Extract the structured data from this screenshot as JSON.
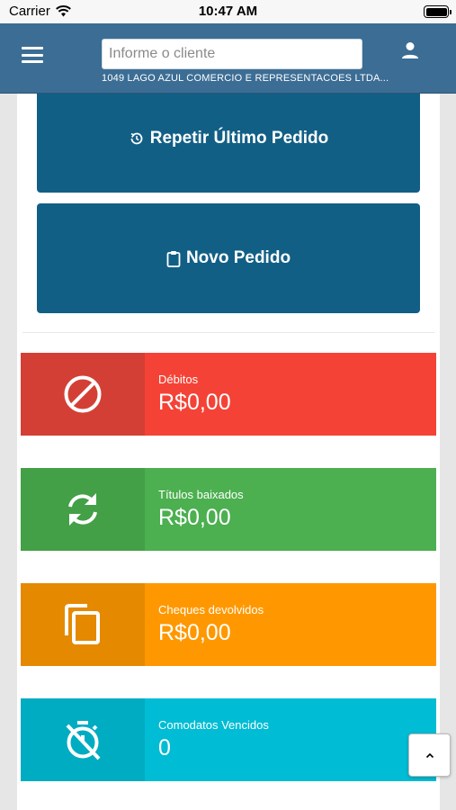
{
  "status_bar": {
    "carrier": "Carrier",
    "time": "10:47 AM"
  },
  "header": {
    "menu_icon": "hamburger-menu-icon",
    "search_placeholder": "Informe o cliente",
    "client_name": "1049 LAGO AZUL COMERCIO E REPRESENTACOES LTDA...",
    "user_icon": "user-icon"
  },
  "actions": {
    "repeat_label": "Repetir Último Pedido",
    "repeat_icon": "history-icon",
    "new_label": "Novo Pedido",
    "new_icon": "clipboard-icon"
  },
  "cards": [
    {
      "label": "Débitos",
      "value": "R$0,00",
      "icon": "block-icon",
      "color": "#f44336",
      "icon_bg": "#d43f35"
    },
    {
      "label": "Títulos baixados",
      "value": "R$0,00",
      "icon": "sync-icon",
      "color": "#4caf50",
      "icon_bg": "#43a047"
    },
    {
      "label": "Cheques devolvidos",
      "value": "R$0,00",
      "icon": "copy-icon",
      "color": "#ff9800",
      "icon_bg": "#e58900"
    },
    {
      "label": "Comodatos Vencidos",
      "value": "0",
      "icon": "timer-off-icon",
      "color": "#00bcd4",
      "icon_bg": "#00acc1"
    }
  ],
  "colors": {
    "header": "#3c6d94",
    "action_button": "#125f86"
  },
  "scroll_top_icon": "chevron-up-icon"
}
